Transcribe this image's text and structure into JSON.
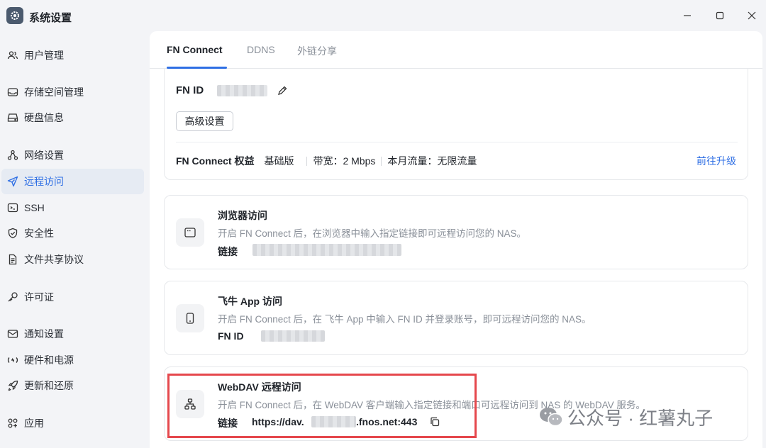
{
  "window": {
    "title": "系统设置"
  },
  "sidebar": {
    "items": [
      {
        "label": "用户管理"
      },
      {
        "label": "存储空间管理"
      },
      {
        "label": "硬盘信息"
      },
      {
        "label": "网络设置"
      },
      {
        "label": "远程访问"
      },
      {
        "label": "SSH"
      },
      {
        "label": "安全性"
      },
      {
        "label": "文件共享协议"
      },
      {
        "label": "许可证"
      },
      {
        "label": "通知设置"
      },
      {
        "label": "硬件和电源"
      },
      {
        "label": "更新和还原"
      },
      {
        "label": "应用"
      }
    ],
    "active": "远程访问"
  },
  "tabs": [
    {
      "label": "FN Connect"
    },
    {
      "label": "DDNS"
    },
    {
      "label": "外链分享"
    }
  ],
  "fn_connect": {
    "fn_id_label": "FN ID",
    "advanced_button": "高级设置",
    "rights_label": "FN Connect 权益",
    "tier": "基础版",
    "bandwidth": "带宽：2 Mbps",
    "traffic": "本月流量：无限流量",
    "upgrade_link": "前往升级"
  },
  "cards": {
    "browser": {
      "title": "浏览器访问",
      "desc": "开启 FN Connect 后，在浏览器中输入指定链接即可远程访问您的 NAS。",
      "label": "链接"
    },
    "app": {
      "title": "飞牛 App 访问",
      "desc": "开启 FN Connect 后，在 飞牛 App 中输入 FN ID 并登录账号，即可远程访问您的 NAS。",
      "label": "FN ID"
    },
    "webdav": {
      "title": "WebDAV 远程访问",
      "desc": "开启 FN Connect 后，在 WebDAV 客户端输入指定链接和端口可远程访问到 NAS 的 WebDAV 服务。",
      "label": "链接",
      "url_prefix": "https://dav.",
      "url_suffix": ".fnos.net:443"
    }
  },
  "watermark": {
    "text": "公众号 · 红薯丸子"
  },
  "colors": {
    "accent": "#2f6fe4",
    "highlight": "#e5484d"
  }
}
